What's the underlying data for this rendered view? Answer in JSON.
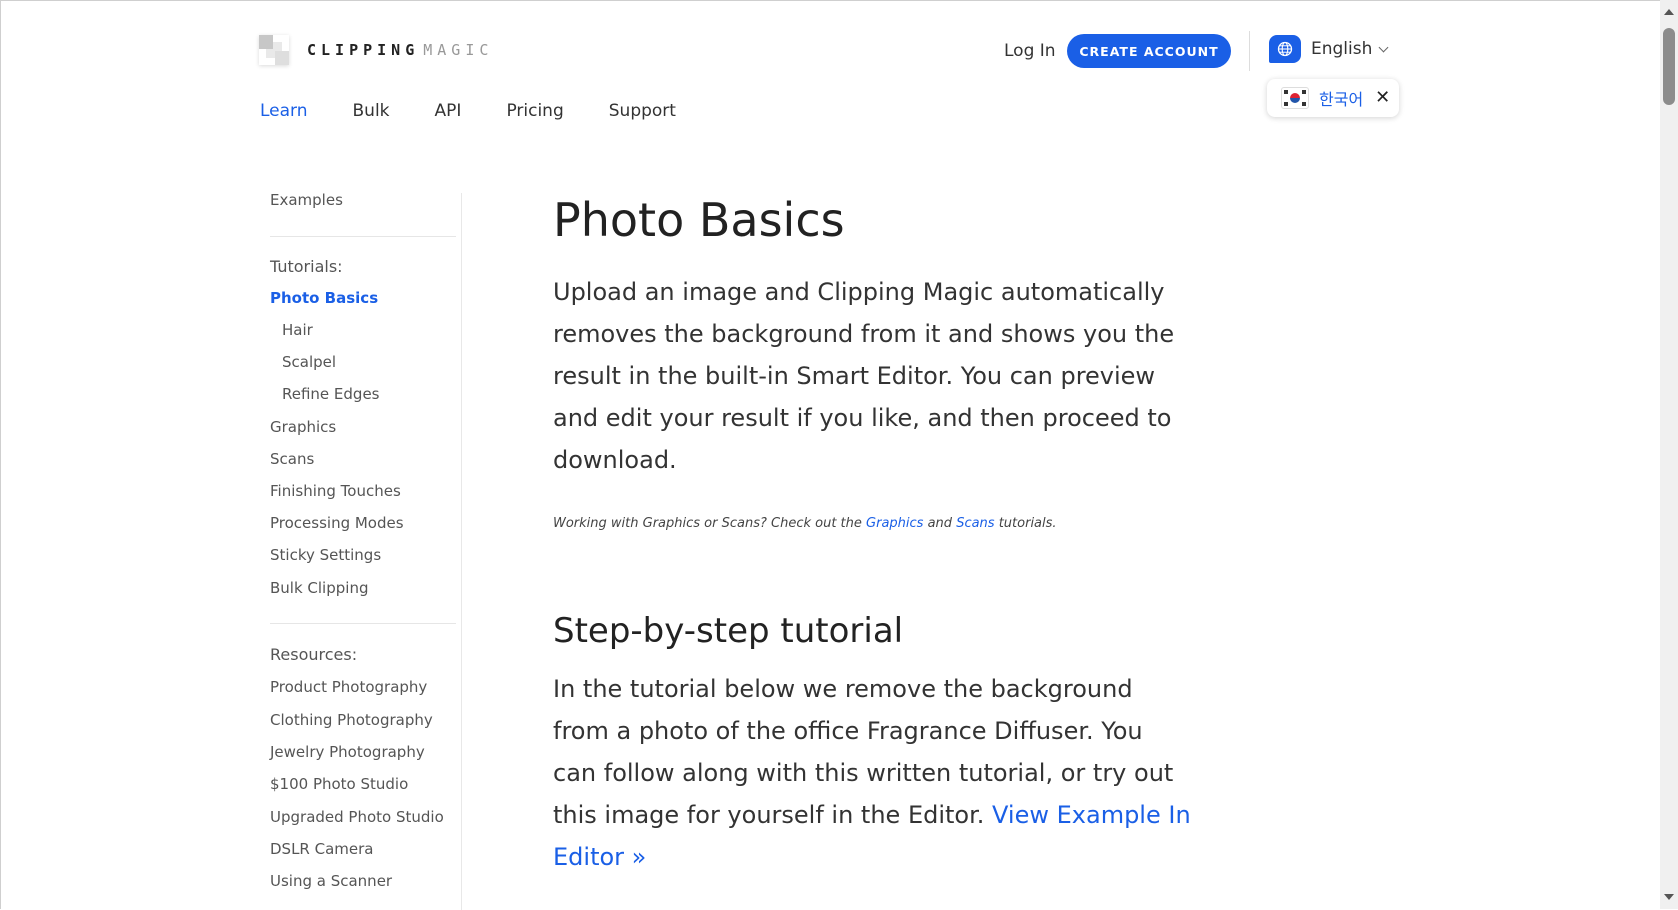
{
  "brand": {
    "name_strong": "CLIPPING",
    "name_light": "MAGIC"
  },
  "header": {
    "login_label": "Log In",
    "create_account_label": "CREATE ACCOUNT",
    "language_label": "English",
    "alt_language_label": "한국어"
  },
  "nav": {
    "items": [
      {
        "label": "Learn"
      },
      {
        "label": "Bulk"
      },
      {
        "label": "API"
      },
      {
        "label": "Pricing"
      },
      {
        "label": "Support"
      }
    ]
  },
  "sidebar": {
    "examples": "Examples",
    "tutorials_heading": "Tutorials:",
    "tutorials": [
      {
        "label": "Photo Basics"
      },
      {
        "label": "Hair"
      },
      {
        "label": "Scalpel"
      },
      {
        "label": "Refine Edges"
      },
      {
        "label": "Graphics"
      },
      {
        "label": "Scans"
      },
      {
        "label": "Finishing Touches"
      },
      {
        "label": "Processing Modes"
      },
      {
        "label": "Sticky Settings"
      },
      {
        "label": "Bulk Clipping"
      }
    ],
    "resources_heading": "Resources:",
    "resources": [
      {
        "label": "Product Photography"
      },
      {
        "label": "Clothing Photography"
      },
      {
        "label": "Jewelry Photography"
      },
      {
        "label": "$100 Photo Studio"
      },
      {
        "label": "Upgraded Photo Studio"
      },
      {
        "label": "DSLR Camera"
      },
      {
        "label": "Using a Scanner"
      }
    ]
  },
  "main": {
    "title": "Photo Basics",
    "intro": "Upload an image and Clipping Magic automatically removes the background from it and shows you the result in the built-in Smart Editor. You can preview and edit your result if you like, and then proceed to download.",
    "note_prefix": "Working with Graphics or Scans? Check out the ",
    "note_link1": "Graphics",
    "note_mid": " and ",
    "note_link2": "Scans",
    "note_suffix": " tutorials.",
    "section_title": "Step-by-step tutorial",
    "section_text": "In the tutorial below we remove the background from a photo of the office Fragrance Diffuser. You can follow along with this written tutorial, or try out this image for yourself in the Editor. ",
    "section_link": "View Example In Editor »"
  },
  "colors": {
    "accent": "#1a5fe6",
    "text": "#333333"
  }
}
